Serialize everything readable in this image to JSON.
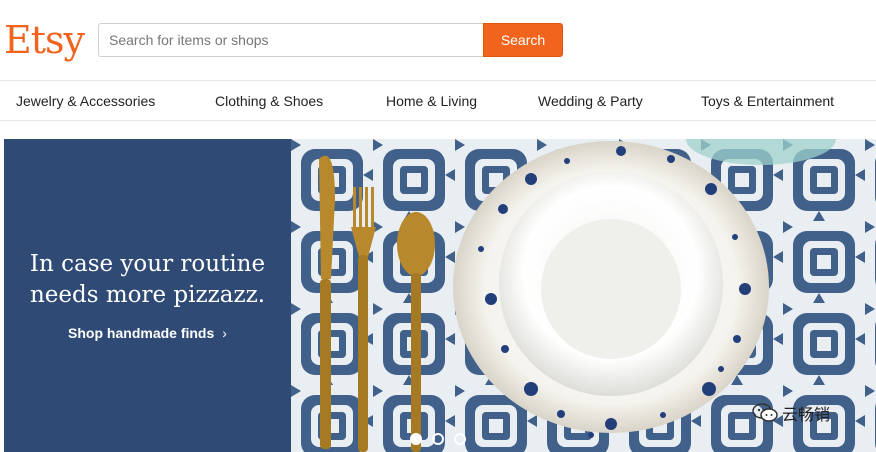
{
  "header": {
    "logo": "Etsy",
    "search_placeholder": "Search for items or shops",
    "search_button": "Search",
    "accent_color": "#f1641e"
  },
  "nav": {
    "categories": [
      "Jewelry & Accessories",
      "Clothing & Shoes",
      "Home & Living",
      "Wedding & Party",
      "Toys & Entertainment"
    ]
  },
  "hero": {
    "headline_line1": "In case your routine",
    "headline_line2": "needs more pizzazz.",
    "link": "Shop handmade finds",
    "link_icon": "chevron-right-icon",
    "panel_color": "#2f4a74",
    "carousel_active_index": 0,
    "carousel_count": 3
  },
  "watermark": {
    "text": "云畅销",
    "icon": "wechat-icon"
  }
}
